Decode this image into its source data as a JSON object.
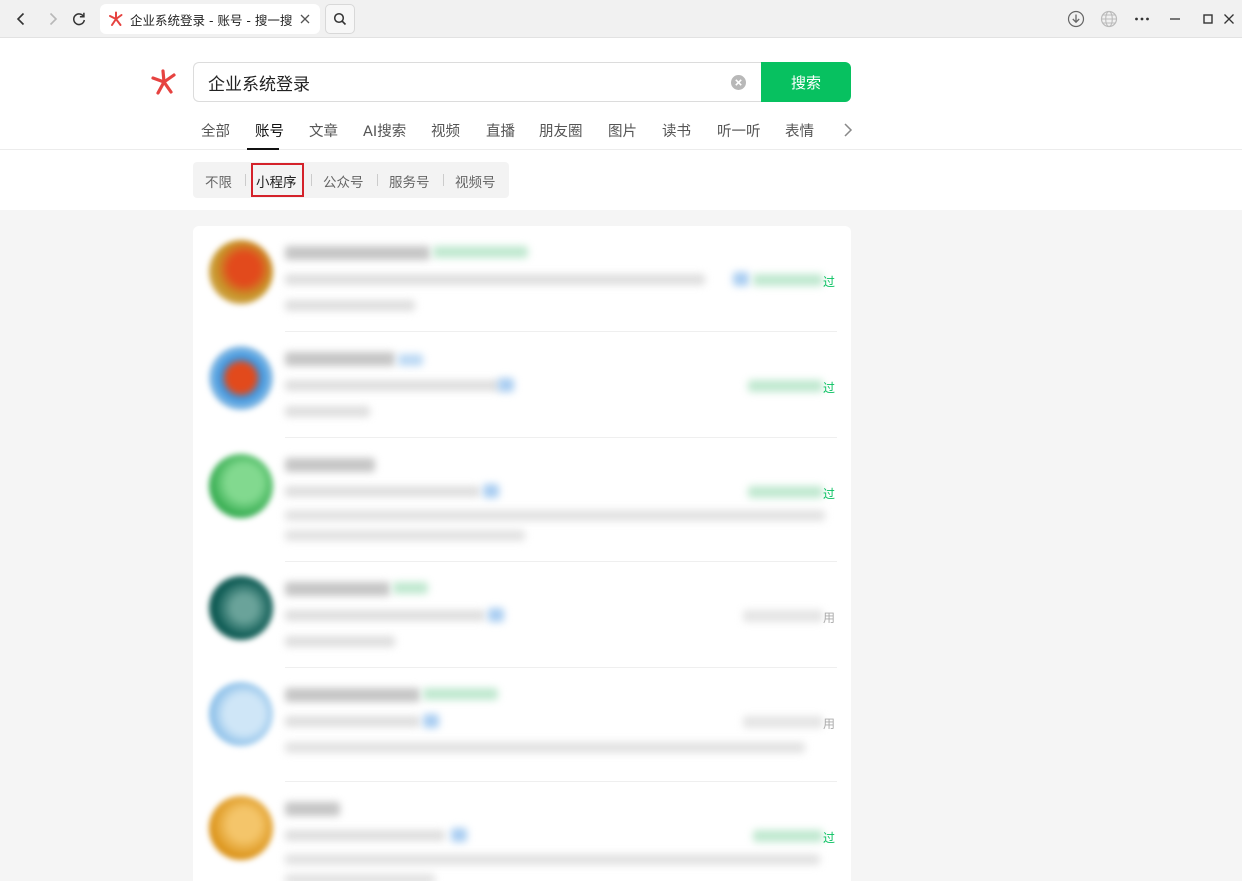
{
  "browser": {
    "tab_title": "企业系统登录 - 账号 - 搜一搜"
  },
  "search": {
    "query": "企业系统登录",
    "button_label": "搜索",
    "accent_color": "#07c160"
  },
  "type_tabs": {
    "items": [
      "全部",
      "账号",
      "文章",
      "AI搜索",
      "视频",
      "直播",
      "朋友圈",
      "图片",
      "读书",
      "听一听",
      "表情"
    ],
    "active": "账号"
  },
  "filters": {
    "items": [
      "不限",
      "小程序",
      "公众号",
      "服务号",
      "视频号"
    ],
    "selected": "小程序",
    "highlight_color": "#d4222a"
  },
  "results": {
    "edge_chars": [
      "过",
      "过",
      "过",
      "用",
      "用",
      "过"
    ]
  }
}
